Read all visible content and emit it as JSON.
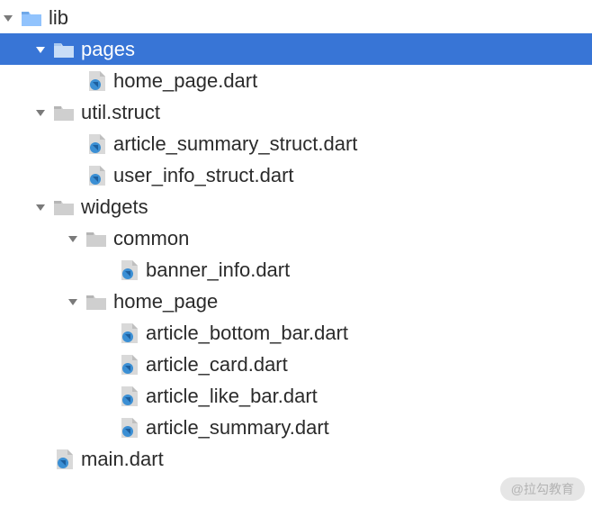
{
  "tree": {
    "lib": "lib",
    "pages": "pages",
    "home_page_dart": "home_page.dart",
    "util_struct": "util.struct",
    "article_summary_struct": "article_summary_struct.dart",
    "user_info_struct": "user_info_struct.dart",
    "widgets": "widgets",
    "common": "common",
    "banner_info": "banner_info.dart",
    "home_page_folder": "home_page",
    "article_bottom_bar": "article_bottom_bar.dart",
    "article_card": "article_card.dart",
    "article_like_bar": "article_like_bar.dart",
    "article_summary": "article_summary.dart",
    "main_dart": "main.dart"
  },
  "watermark": "@拉勾教育"
}
